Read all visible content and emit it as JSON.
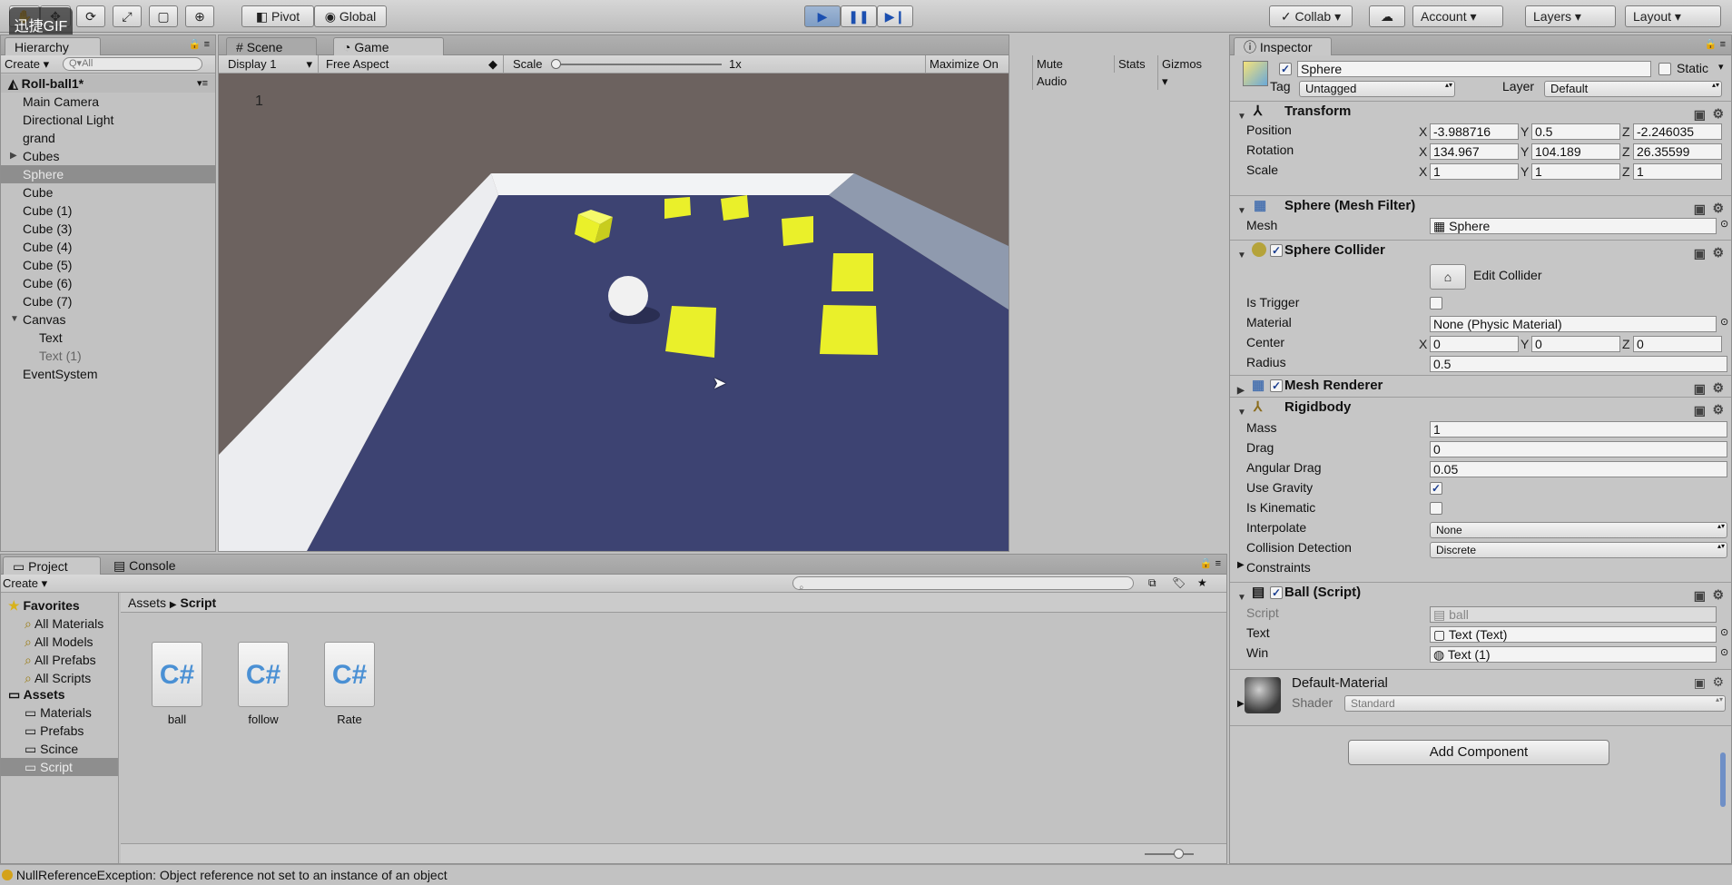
{
  "watermark": "迅捷GIF",
  "toolbar": {
    "pivot": "Pivot",
    "global": "Global",
    "collab": "Collab",
    "account": "Account",
    "layers": "Layers",
    "layout": "Layout"
  },
  "hierarchy": {
    "tab": "Hierarchy",
    "create": "Create",
    "search_placeholder": "Q▾All",
    "scene": "Roll-ball1*",
    "items": [
      {
        "label": "Main Camera",
        "indent": 1
      },
      {
        "label": "Directional Light",
        "indent": 1
      },
      {
        "label": "grand",
        "indent": 1
      },
      {
        "label": "Cubes",
        "indent": 1,
        "expander": "▶"
      },
      {
        "label": "Sphere",
        "indent": 1,
        "selected": true
      },
      {
        "label": "Cube",
        "indent": 1
      },
      {
        "label": "Cube (1)",
        "indent": 1
      },
      {
        "label": "Cube (3)",
        "indent": 1
      },
      {
        "label": "Cube (4)",
        "indent": 1
      },
      {
        "label": "Cube (5)",
        "indent": 1
      },
      {
        "label": "Cube (6)",
        "indent": 1
      },
      {
        "label": "Cube (7)",
        "indent": 1
      },
      {
        "label": "Canvas",
        "indent": 1,
        "expander": "▼"
      },
      {
        "label": "Text",
        "indent": 2
      },
      {
        "label": "Text (1)",
        "indent": 2,
        "dim": true
      },
      {
        "label": "EventSystem",
        "indent": 1
      }
    ]
  },
  "game": {
    "tab_scene": "Scene",
    "tab_game": "Game",
    "display": "Display 1",
    "aspect": "Free Aspect",
    "scale_label": "Scale",
    "scale_value": "1x",
    "maximize": "Maximize On Play",
    "mute": "Mute Audio",
    "stats": "Stats",
    "gizmos": "Gizmos",
    "score_text": "1"
  },
  "project": {
    "tab_project": "Project",
    "tab_console": "Console",
    "create": "Create",
    "favorites_label": "Favorites",
    "favorites": [
      "All Materials",
      "All Models",
      "All Prefabs",
      "All Scripts"
    ],
    "assets_label": "Assets",
    "folders": [
      "Materials",
      "Prefabs",
      "Scince",
      "Script"
    ],
    "selected_folder": "Script",
    "breadcrumb_root": "Assets",
    "breadcrumb_leaf": "Script",
    "files": [
      "ball",
      "follow",
      "Rate"
    ],
    "file_glyph": "C#"
  },
  "inspector": {
    "tab": "Inspector",
    "object_name": "Sphere",
    "static_label": "Static",
    "tag_label": "Tag",
    "tag_value": "Untagged",
    "layer_label": "Layer",
    "layer_value": "Default",
    "transform": {
      "title": "Transform",
      "position_label": "Position",
      "position": [
        "-3.988716",
        "0.5",
        "-2.246035"
      ],
      "rotation_label": "Rotation",
      "rotation": [
        "134.967",
        "104.189",
        "26.35599"
      ],
      "scale_label": "Scale",
      "scale": [
        "1",
        "1",
        "1"
      ]
    },
    "mesh_filter": {
      "title": "Sphere (Mesh Filter)",
      "mesh_label": "Mesh",
      "mesh_value": "Sphere"
    },
    "collider": {
      "title": "Sphere Collider",
      "edit_label": "Edit Collider",
      "is_trigger_label": "Is Trigger",
      "material_label": "Material",
      "material_value": "None (Physic Material)",
      "center_label": "Center",
      "center": [
        "0",
        "0",
        "0"
      ],
      "radius_label": "Radius",
      "radius": "0.5"
    },
    "mesh_renderer": {
      "title": "Mesh Renderer"
    },
    "rigidbody": {
      "title": "Rigidbody",
      "mass_label": "Mass",
      "mass": "1",
      "drag_label": "Drag",
      "drag": "0",
      "angular_label": "Angular Drag",
      "angular": "0.05",
      "gravity_label": "Use Gravity",
      "kinematic_label": "Is Kinematic",
      "interpolate_label": "Interpolate",
      "interpolate": "None",
      "collision_label": "Collision Detection",
      "collision": "Discrete",
      "constraints_label": "Constraints"
    },
    "ball_script": {
      "title": "Ball (Script)",
      "script_label": "Script",
      "script_value": "ball",
      "text_label": "Text",
      "text_value": "Text (Text)",
      "win_label": "Win",
      "win_value": "Text (1)"
    },
    "material": {
      "name": "Default-Material",
      "shader_label": "Shader",
      "shader_value": "Standard"
    },
    "add_component": "Add Component"
  },
  "status": {
    "message": "NullReferenceException: Object reference not set to an instance of an object"
  },
  "colors": {
    "floor": "#3d4372",
    "cube": "#eaf02a",
    "wall": "#ecedf0",
    "background": "#6c625f"
  },
  "axis_x": "X",
  "axis_y": "Y",
  "axis_z": "Z"
}
